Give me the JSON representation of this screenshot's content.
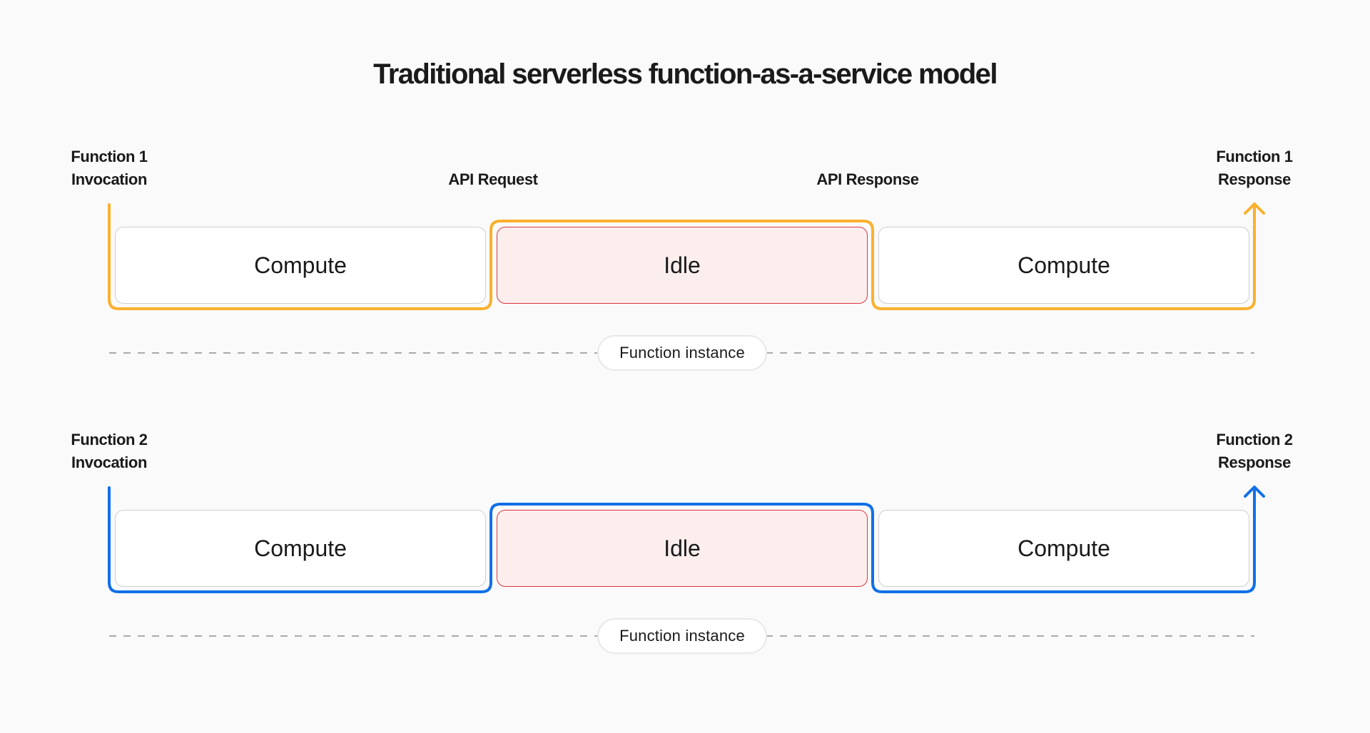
{
  "title": "Traditional serverless function-as-a-service model",
  "colors": {
    "function1": "#fbb02d",
    "function2": "#1170e8",
    "idle_fill": "#fdeeee",
    "idle_border": "#d9363e",
    "compute_border": "#cfcfcf",
    "dashed_line": "#aaaaaa"
  },
  "api_labels": {
    "request": "API Request",
    "response": "API Response"
  },
  "rows": [
    {
      "invocation": {
        "line1": "Function 1",
        "line2": "Invocation"
      },
      "response": {
        "line1": "Function 1",
        "line2": "Response"
      },
      "segments": [
        {
          "type": "compute",
          "label": "Compute"
        },
        {
          "type": "idle",
          "label": "Idle"
        },
        {
          "type": "compute",
          "label": "Compute"
        }
      ],
      "instance_label": "Function instance"
    },
    {
      "invocation": {
        "line1": "Function 2",
        "line2": "Invocation"
      },
      "response": {
        "line1": "Function 2",
        "line2": "Response"
      },
      "segments": [
        {
          "type": "compute",
          "label": "Compute"
        },
        {
          "type": "idle",
          "label": "Idle"
        },
        {
          "type": "compute",
          "label": "Compute"
        }
      ],
      "instance_label": "Function instance"
    }
  ]
}
